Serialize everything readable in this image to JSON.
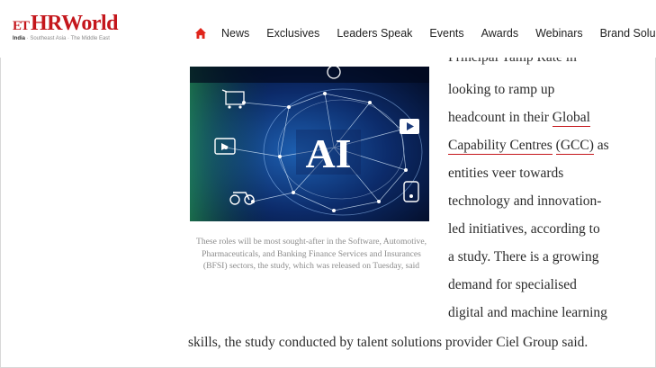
{
  "header": {
    "logo_badge": "ET",
    "logo_text": "HRWorld",
    "edition_active": "India",
    "edition_others": " · Southeast Asia · The Middle East",
    "nav": [
      "News",
      "Exclusives",
      "Leaders Speak",
      "Events",
      "Awards",
      "Webinars",
      "Brand Solu"
    ]
  },
  "hero": {
    "label": "AI"
  },
  "caption": "These roles will be most sought-after in the Software, Automotive, Pharmaceuticals, and Banking Finance Services and Insurances (BFSI) sectors, the study, which was released on Tuesday, said",
  "article": {
    "partial": "Principal Tamp Rate in",
    "l1": "looking to ramp up",
    "l2a": "headcount in their ",
    "l2b": "Global",
    "l3a": "Capability Centres",
    "l3b": " ",
    "l3c": "(GCC)",
    "l3d": " as",
    "l4": "entities veer towards",
    "l5": "technology and innovation-",
    "l6": "led initiatives, according to",
    "l7": "a study. There is a growing",
    "l8": "demand for specialised",
    "l9": "digital and machine learning",
    "last": "skills, the study conducted by talent solutions provider Ciel Group said."
  },
  "colors": {
    "brand": "#c4161c",
    "text": "#2b2b2b",
    "caption": "#8b8b8b"
  }
}
